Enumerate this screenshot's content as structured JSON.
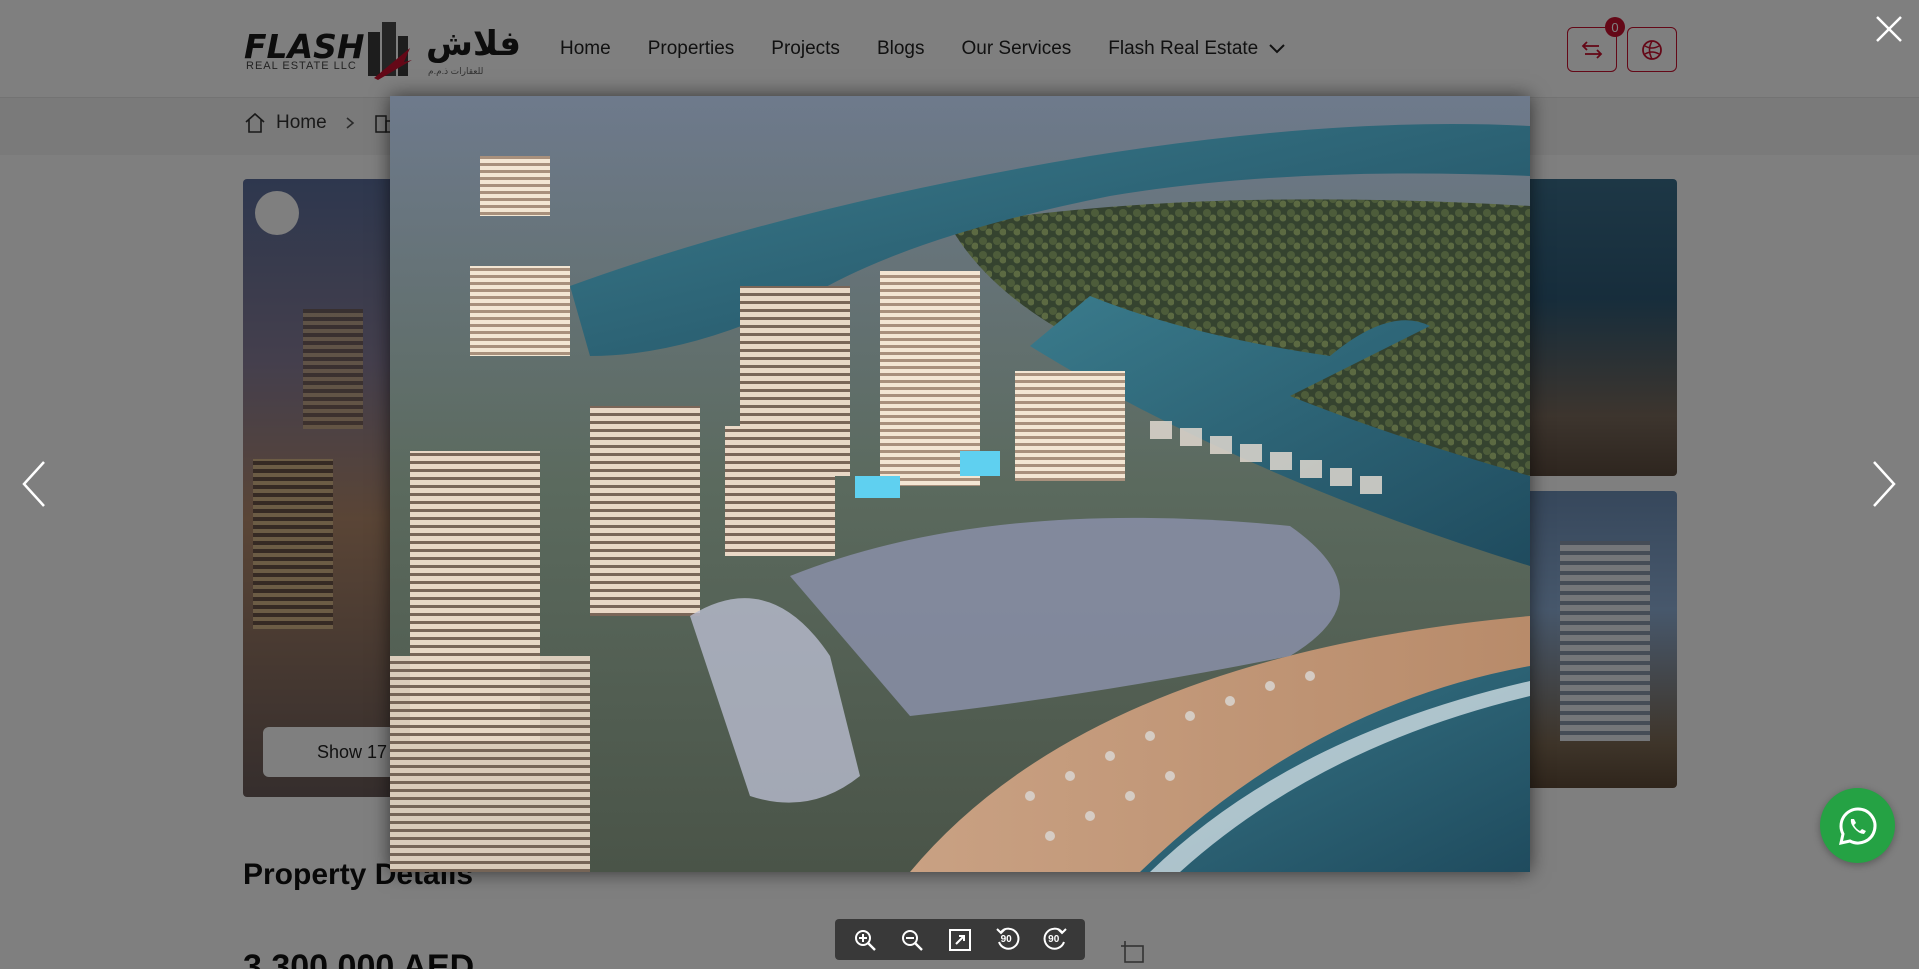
{
  "header": {
    "logo": {
      "en": "FLASH",
      "en_sub": "REAL ESTATE LLC",
      "ar": "فلاش",
      "ar_sub": "للعقارات ذ.م.م"
    },
    "nav": [
      {
        "label": "Home"
      },
      {
        "label": "Properties"
      },
      {
        "label": "Projects"
      },
      {
        "label": "Blogs"
      },
      {
        "label": "Our Services"
      },
      {
        "label": "Flash Real Estate"
      }
    ],
    "compare_count": "0",
    "icons": {
      "compare": "swap-arrows-icon",
      "language": "globe-icon",
      "dropdown": "chevron-down-icon"
    }
  },
  "breadcrumb": {
    "home_label": "Home"
  },
  "gallery": {
    "show_label": "Show 17"
  },
  "details": {
    "section_title": "Property Details",
    "price": "3,300,000 AED"
  },
  "viewer": {
    "toolbar_icons": [
      "zoom-in-icon",
      "zoom-out-icon",
      "fit-screen-icon",
      "rotate-left-90-icon",
      "rotate-right-90-icon"
    ],
    "rotate_left_label": "90",
    "rotate_right_label": "90"
  },
  "colors": {
    "brand_red": "#c8102e",
    "whatsapp_green": "#25a244",
    "overlay": "rgba(0,0,0,0.5)"
  }
}
